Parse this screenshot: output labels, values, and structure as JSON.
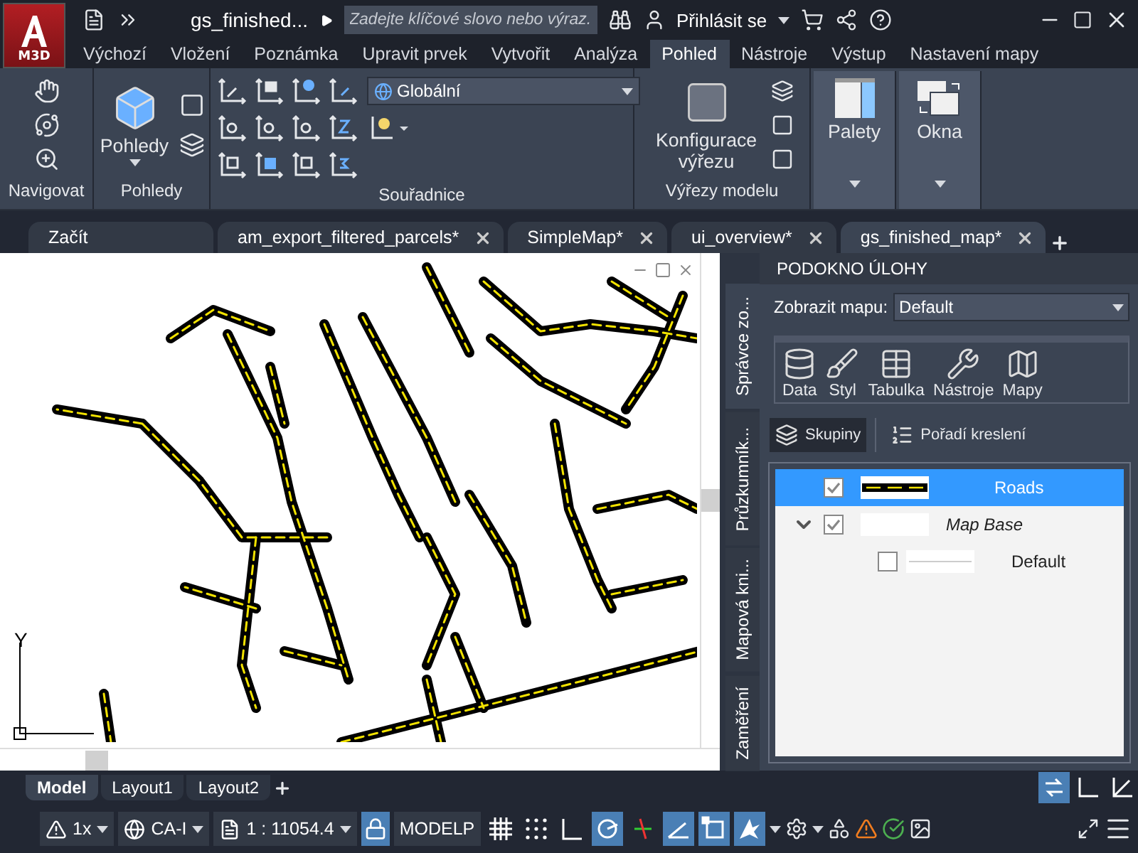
{
  "app_menu": {
    "label": "M3D"
  },
  "title_bar": {
    "title": "gs_finished...",
    "search": {
      "placeholder": "Zadejte klíčové slovo nebo výraz."
    },
    "sign_in": "Přihlásit se"
  },
  "ribbon_tabs": [
    {
      "label": "Výchozí",
      "selected": false
    },
    {
      "label": "Vložení",
      "selected": false
    },
    {
      "label": "Poznámka",
      "selected": false
    },
    {
      "label": "Upravit prvek",
      "selected": false
    },
    {
      "label": "Vytvořit",
      "selected": false
    },
    {
      "label": "Analýza",
      "selected": false
    },
    {
      "label": "Pohled",
      "selected": true
    },
    {
      "label": "Nástroje",
      "selected": false
    },
    {
      "label": "Výstup",
      "selected": false
    },
    {
      "label": "Nastavení mapy",
      "selected": false
    }
  ],
  "ribbon": {
    "navigate": {
      "title": "Navigovat"
    },
    "views": {
      "button": "Pohledy",
      "title": "Pohledy"
    },
    "coordinates": {
      "ucs": "Globální",
      "title": "Souřadnice"
    },
    "viewports": {
      "button": "Konfigurace výřezu",
      "title": "Výřezy modelu"
    },
    "palettes": {
      "button": "Palety"
    },
    "windows": {
      "button": "Okna"
    }
  },
  "doc_tabs": [
    {
      "label": "Začít",
      "selected": false,
      "closable": false
    },
    {
      "label": "am_export_filtered_parcels*",
      "selected": false,
      "closable": true
    },
    {
      "label": "SimpleMap*",
      "selected": false,
      "closable": true
    },
    {
      "label": "ui_overview*",
      "selected": false,
      "closable": true
    },
    {
      "label": "gs_finished_map*",
      "selected": true,
      "closable": true
    }
  ],
  "viewport": {
    "ucs_label": "Y"
  },
  "task_pane": {
    "title": "PODOKNO ÚLOHY",
    "side_tabs": [
      {
        "label": "Správce zo...",
        "selected": true
      },
      {
        "label": "Průzkumník...",
        "selected": false
      },
      {
        "label": "Mapová kni...",
        "selected": false
      },
      {
        "label": "Zaměření",
        "selected": false
      }
    ],
    "map_selector": {
      "label": "Zobrazit mapu:",
      "value": "Default"
    },
    "tools": [
      {
        "kind": "data",
        "label": "Data"
      },
      {
        "kind": "style",
        "label": "Styl"
      },
      {
        "kind": "table",
        "label": "Tabulka"
      },
      {
        "kind": "tools",
        "label": "Nástroje"
      },
      {
        "kind": "maps",
        "label": "Mapy"
      }
    ],
    "view_modes": [
      {
        "kind": "groups",
        "label": "Skupiny",
        "selected": true
      },
      {
        "kind": "order",
        "label": "Pořadí kreslení",
        "selected": false
      }
    ],
    "layers": [
      {
        "kind": "layer",
        "name": "Roads",
        "checked": true,
        "selected": true
      },
      {
        "kind": "group",
        "name": "Map Base",
        "checked": true,
        "selected": false,
        "expanded": true,
        "children": [
          {
            "kind": "style",
            "name": "Default",
            "checked": false,
            "selected": false
          }
        ]
      }
    ]
  },
  "layout_tabs": [
    {
      "label": "Model",
      "selected": true
    },
    {
      "label": "Layout1",
      "selected": false
    },
    {
      "label": "Layout2",
      "selected": false
    }
  ],
  "model_tools": [
    {
      "kind": "swap",
      "on": true
    },
    {
      "kind": "ortho",
      "on": false
    },
    {
      "kind": "axes",
      "on": false
    }
  ],
  "status_bar": {
    "annotation_scale": "1x",
    "coordinate_system": "CA-I",
    "scale": "1 : 11054.4",
    "space": "MODELP",
    "toggles": [
      {
        "kind": "lock",
        "on": true
      },
      {
        "kind": "grid",
        "on": false
      },
      {
        "kind": "snap",
        "on": false
      },
      {
        "kind": "ortho",
        "on": false
      },
      {
        "kind": "polar",
        "on": true
      },
      {
        "kind": "osnap",
        "on": false
      },
      {
        "kind": "angle",
        "on": true
      },
      {
        "kind": "select",
        "on": true
      },
      {
        "kind": "annotate",
        "on": true
      }
    ]
  }
}
